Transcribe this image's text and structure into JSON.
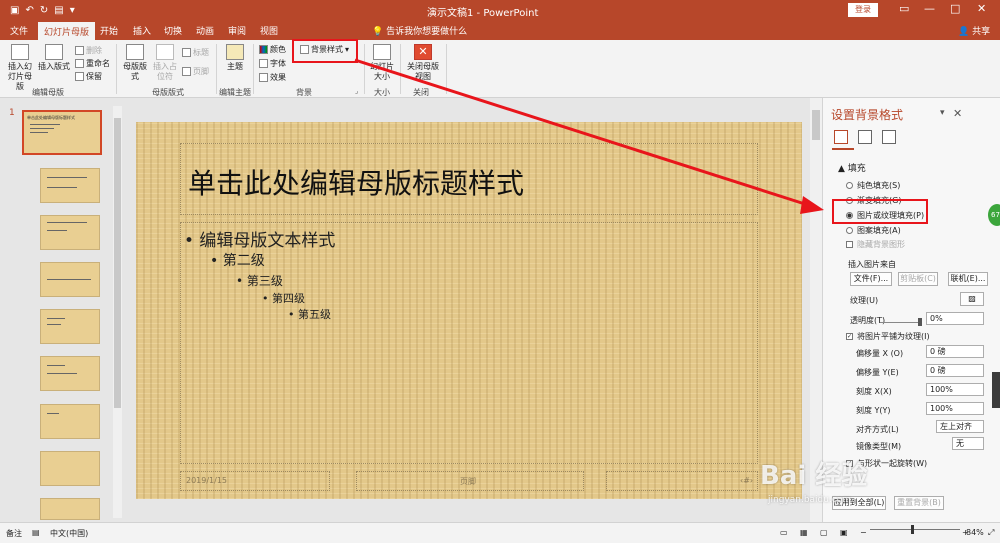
{
  "window": {
    "title": "演示文稿1 - PowerPoint",
    "login": "登录"
  },
  "tabs": [
    {
      "label": "文件"
    },
    {
      "label": "幻灯片母版"
    },
    {
      "label": "开始"
    },
    {
      "label": "插入"
    },
    {
      "label": "切换"
    },
    {
      "label": "动画"
    },
    {
      "label": "审阅"
    },
    {
      "label": "视图"
    }
  ],
  "tell_me": "告诉我你想要做什么",
  "share": "共享",
  "ribbon": {
    "insert_master": "插入幻灯片母版",
    "insert_layout": "插入版式",
    "delete": "删除",
    "rename": "重命名",
    "preserve": "保留",
    "group_edit_master": "编辑母版",
    "master_layout": "母版版式",
    "insert_placeholder": "插入占位符",
    "title_chk": "标题",
    "footer_chk": "页脚",
    "group_master_layout": "母版版式",
    "theme": "主题",
    "group_edit_theme": "编辑主题",
    "colors": "颜色",
    "fonts": "字体",
    "effects": "效果",
    "background_styles": "背景样式",
    "group_background": "背景",
    "slide_size": "幻灯片大小",
    "group_size": "大小",
    "close_master": "关闭母版视图",
    "group_close": "关闭"
  },
  "thumbs": {
    "slide_number": "1",
    "master_title": "单击此处编辑母版标题样式"
  },
  "slide": {
    "title": "单击此处编辑母版标题样式",
    "bullet1": "• 编辑母版文本样式",
    "bullet2": "• 第二级",
    "bullet3": "• 第三级",
    "bullet4": "• 第四级",
    "bullet5": "• 第五级",
    "date": "2019/1/15",
    "footer": "页脚",
    "page_num": "‹#›"
  },
  "pane": {
    "title": "设置背景格式",
    "fill_section": "▲ 填充",
    "solid_fill": "纯色填充(S)",
    "gradient_fill": "渐变填充(G)",
    "picture_fill": "图片或纹理填充(P)",
    "pattern_fill": "图案填充(A)",
    "hide_bg": "隐藏背景图形",
    "insert_from": "插入图片来自",
    "file_btn": "文件(F)...",
    "clipboard_btn": "剪贴板(C)",
    "online_btn": "联机(E)...",
    "texture": "纹理(U)",
    "transparency": "透明度(T)",
    "transparency_val": "0%",
    "tile_chk": "将图片平铺为纹理(I)",
    "offset_x": "偏移量 X (O)",
    "offset_x_val": "0 磅",
    "offset_y": "偏移量 Y(E)",
    "offset_y_val": "0 磅",
    "scale_x": "刻度 X(X)",
    "scale_x_val": "100%",
    "scale_y": "刻度 Y(Y)",
    "scale_y_val": "100%",
    "alignment": "对齐方式(L)",
    "alignment_val": "左上对齐",
    "mirror": "镜像类型(M)",
    "mirror_val": "无",
    "rotate_with": "与形状一起旋转(W)",
    "apply_all": "应用到全部(L)",
    "reset_bg": "重置背景(B)",
    "badge": "67"
  },
  "status": {
    "notes": "备注",
    "language": "中文(中国)",
    "zoom": "84%"
  },
  "watermark": {
    "brand": "Bai  经验",
    "url": "jingyan.baidu.com"
  }
}
